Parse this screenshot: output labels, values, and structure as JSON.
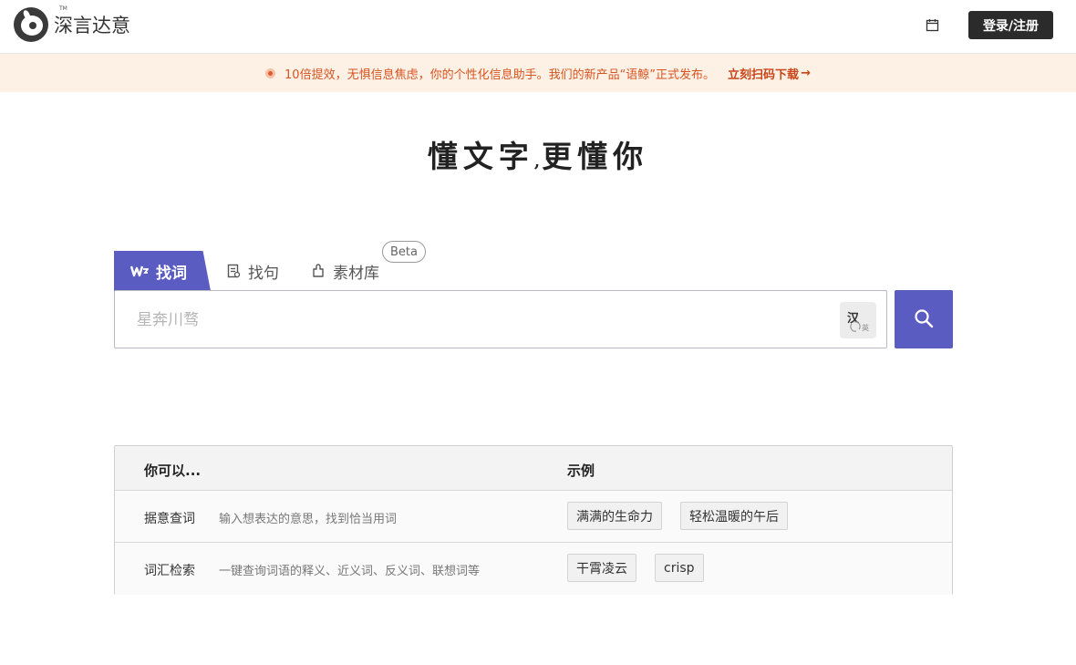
{
  "brand": {
    "name": "深言达意",
    "tm": "TM"
  },
  "header": {
    "calendar_icon": "calendar-icon",
    "login_label": "登录/注册"
  },
  "banner": {
    "text": "10倍提效，无惧信息焦虑，你的个性化信息助手。我们的新产品“语鲸”正式发布。",
    "link_label": "立刻扫码下载",
    "arrow": "→",
    "color": "#d9531e"
  },
  "slogan": {
    "left": "懂文字",
    "separator": ",",
    "right": "更懂你"
  },
  "tabs": [
    {
      "label": "找词",
      "icon": "word-icon",
      "active": true
    },
    {
      "label": "找句",
      "icon": "document-icon",
      "active": false
    },
    {
      "label": "素材库",
      "icon": "puzzle-icon",
      "active": false
    }
  ],
  "beta_label": "Beta",
  "search": {
    "placeholder": "星奔川骛",
    "value": "",
    "lang_zh": "汉",
    "lang_en": "英",
    "button_icon": "search-icon",
    "accent": "#5b5cc2"
  },
  "guide": {
    "col_can": "你可以...",
    "col_examples": "示例",
    "rows": [
      {
        "title": "据意查词",
        "desc": "输入想表达的意思，找到恰当用词",
        "examples": [
          "满满的生命力",
          "轻松温暖的午后"
        ]
      },
      {
        "title": "词汇检索",
        "desc": "一键查询词语的释义、近义词、反义词、联想词等",
        "examples": [
          "干霄凌云",
          "crisp"
        ]
      }
    ]
  }
}
